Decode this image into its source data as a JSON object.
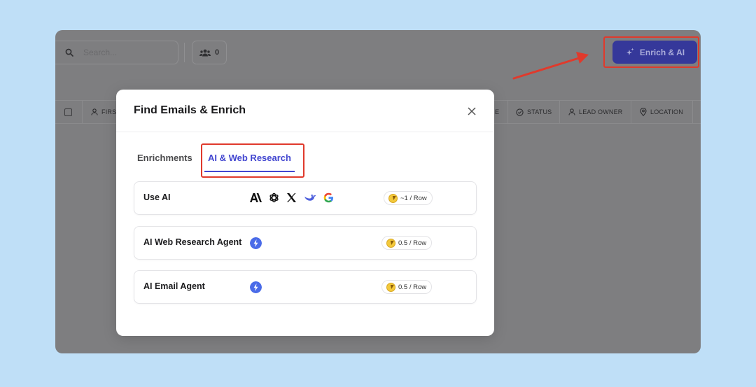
{
  "toolbar": {
    "search_placeholder": "Search...",
    "people_count": "0",
    "enrich_button_label": "Enrich & AI"
  },
  "table": {
    "columns": [
      {
        "label": "FIRS",
        "icon": "user-icon"
      },
      {
        "label": "E",
        "icon": "none"
      },
      {
        "label": "STATUS",
        "icon": "check-circle-icon"
      },
      {
        "label": "LEAD OWNER",
        "icon": "user-icon"
      },
      {
        "label": "LOCATION",
        "icon": "pin-icon"
      }
    ]
  },
  "modal": {
    "title": "Find Emails & Enrich",
    "tabs": [
      {
        "label": "Enrichments",
        "active": false
      },
      {
        "label": "AI & Web Research",
        "active": true
      }
    ],
    "options": [
      {
        "label": "Use AI",
        "cost": "~1 / Row",
        "icons": [
          "anthropic-icon",
          "openai-icon",
          "x-icon",
          "deepseek-icon",
          "google-icon"
        ]
      },
      {
        "label": "AI Web Research Agent",
        "cost": "0.5 / Row",
        "icons": [
          "bolt-icon"
        ]
      },
      {
        "label": "AI Email Agent",
        "cost": "0.5 / Row",
        "icons": [
          "bolt-icon"
        ]
      }
    ]
  },
  "colors": {
    "accent": "#4246d0",
    "highlight": "#e03a2c",
    "enrich_button": "#35389a",
    "page_background": "#bfdff7"
  }
}
